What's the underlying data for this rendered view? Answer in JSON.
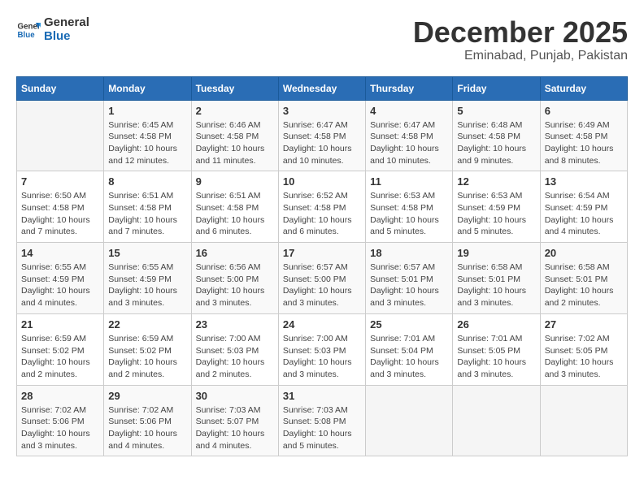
{
  "logo": {
    "line1": "General",
    "line2": "Blue"
  },
  "header": {
    "month": "December 2025",
    "location": "Eminabad, Punjab, Pakistan"
  },
  "days_header": [
    "Sunday",
    "Monday",
    "Tuesday",
    "Wednesday",
    "Thursday",
    "Friday",
    "Saturday"
  ],
  "weeks": [
    [
      {
        "day": "",
        "info": ""
      },
      {
        "day": "1",
        "info": "Sunrise: 6:45 AM\nSunset: 4:58 PM\nDaylight: 10 hours\nand 12 minutes."
      },
      {
        "day": "2",
        "info": "Sunrise: 6:46 AM\nSunset: 4:58 PM\nDaylight: 10 hours\nand 11 minutes."
      },
      {
        "day": "3",
        "info": "Sunrise: 6:47 AM\nSunset: 4:58 PM\nDaylight: 10 hours\nand 10 minutes."
      },
      {
        "day": "4",
        "info": "Sunrise: 6:47 AM\nSunset: 4:58 PM\nDaylight: 10 hours\nand 10 minutes."
      },
      {
        "day": "5",
        "info": "Sunrise: 6:48 AM\nSunset: 4:58 PM\nDaylight: 10 hours\nand 9 minutes."
      },
      {
        "day": "6",
        "info": "Sunrise: 6:49 AM\nSunset: 4:58 PM\nDaylight: 10 hours\nand 8 minutes."
      }
    ],
    [
      {
        "day": "7",
        "info": "Sunrise: 6:50 AM\nSunset: 4:58 PM\nDaylight: 10 hours\nand 7 minutes."
      },
      {
        "day": "8",
        "info": "Sunrise: 6:51 AM\nSunset: 4:58 PM\nDaylight: 10 hours\nand 7 minutes."
      },
      {
        "day": "9",
        "info": "Sunrise: 6:51 AM\nSunset: 4:58 PM\nDaylight: 10 hours\nand 6 minutes."
      },
      {
        "day": "10",
        "info": "Sunrise: 6:52 AM\nSunset: 4:58 PM\nDaylight: 10 hours\nand 6 minutes."
      },
      {
        "day": "11",
        "info": "Sunrise: 6:53 AM\nSunset: 4:58 PM\nDaylight: 10 hours\nand 5 minutes."
      },
      {
        "day": "12",
        "info": "Sunrise: 6:53 AM\nSunset: 4:59 PM\nDaylight: 10 hours\nand 5 minutes."
      },
      {
        "day": "13",
        "info": "Sunrise: 6:54 AM\nSunset: 4:59 PM\nDaylight: 10 hours\nand 4 minutes."
      }
    ],
    [
      {
        "day": "14",
        "info": "Sunrise: 6:55 AM\nSunset: 4:59 PM\nDaylight: 10 hours\nand 4 minutes."
      },
      {
        "day": "15",
        "info": "Sunrise: 6:55 AM\nSunset: 4:59 PM\nDaylight: 10 hours\nand 3 minutes."
      },
      {
        "day": "16",
        "info": "Sunrise: 6:56 AM\nSunset: 5:00 PM\nDaylight: 10 hours\nand 3 minutes."
      },
      {
        "day": "17",
        "info": "Sunrise: 6:57 AM\nSunset: 5:00 PM\nDaylight: 10 hours\nand 3 minutes."
      },
      {
        "day": "18",
        "info": "Sunrise: 6:57 AM\nSunset: 5:01 PM\nDaylight: 10 hours\nand 3 minutes."
      },
      {
        "day": "19",
        "info": "Sunrise: 6:58 AM\nSunset: 5:01 PM\nDaylight: 10 hours\nand 3 minutes."
      },
      {
        "day": "20",
        "info": "Sunrise: 6:58 AM\nSunset: 5:01 PM\nDaylight: 10 hours\nand 2 minutes."
      }
    ],
    [
      {
        "day": "21",
        "info": "Sunrise: 6:59 AM\nSunset: 5:02 PM\nDaylight: 10 hours\nand 2 minutes."
      },
      {
        "day": "22",
        "info": "Sunrise: 6:59 AM\nSunset: 5:02 PM\nDaylight: 10 hours\nand 2 minutes."
      },
      {
        "day": "23",
        "info": "Sunrise: 7:00 AM\nSunset: 5:03 PM\nDaylight: 10 hours\nand 2 minutes."
      },
      {
        "day": "24",
        "info": "Sunrise: 7:00 AM\nSunset: 5:03 PM\nDaylight: 10 hours\nand 3 minutes."
      },
      {
        "day": "25",
        "info": "Sunrise: 7:01 AM\nSunset: 5:04 PM\nDaylight: 10 hours\nand 3 minutes."
      },
      {
        "day": "26",
        "info": "Sunrise: 7:01 AM\nSunset: 5:05 PM\nDaylight: 10 hours\nand 3 minutes."
      },
      {
        "day": "27",
        "info": "Sunrise: 7:02 AM\nSunset: 5:05 PM\nDaylight: 10 hours\nand 3 minutes."
      }
    ],
    [
      {
        "day": "28",
        "info": "Sunrise: 7:02 AM\nSunset: 5:06 PM\nDaylight: 10 hours\nand 3 minutes."
      },
      {
        "day": "29",
        "info": "Sunrise: 7:02 AM\nSunset: 5:06 PM\nDaylight: 10 hours\nand 4 minutes."
      },
      {
        "day": "30",
        "info": "Sunrise: 7:03 AM\nSunset: 5:07 PM\nDaylight: 10 hours\nand 4 minutes."
      },
      {
        "day": "31",
        "info": "Sunrise: 7:03 AM\nSunset: 5:08 PM\nDaylight: 10 hours\nand 5 minutes."
      },
      {
        "day": "",
        "info": ""
      },
      {
        "day": "",
        "info": ""
      },
      {
        "day": "",
        "info": ""
      }
    ]
  ]
}
